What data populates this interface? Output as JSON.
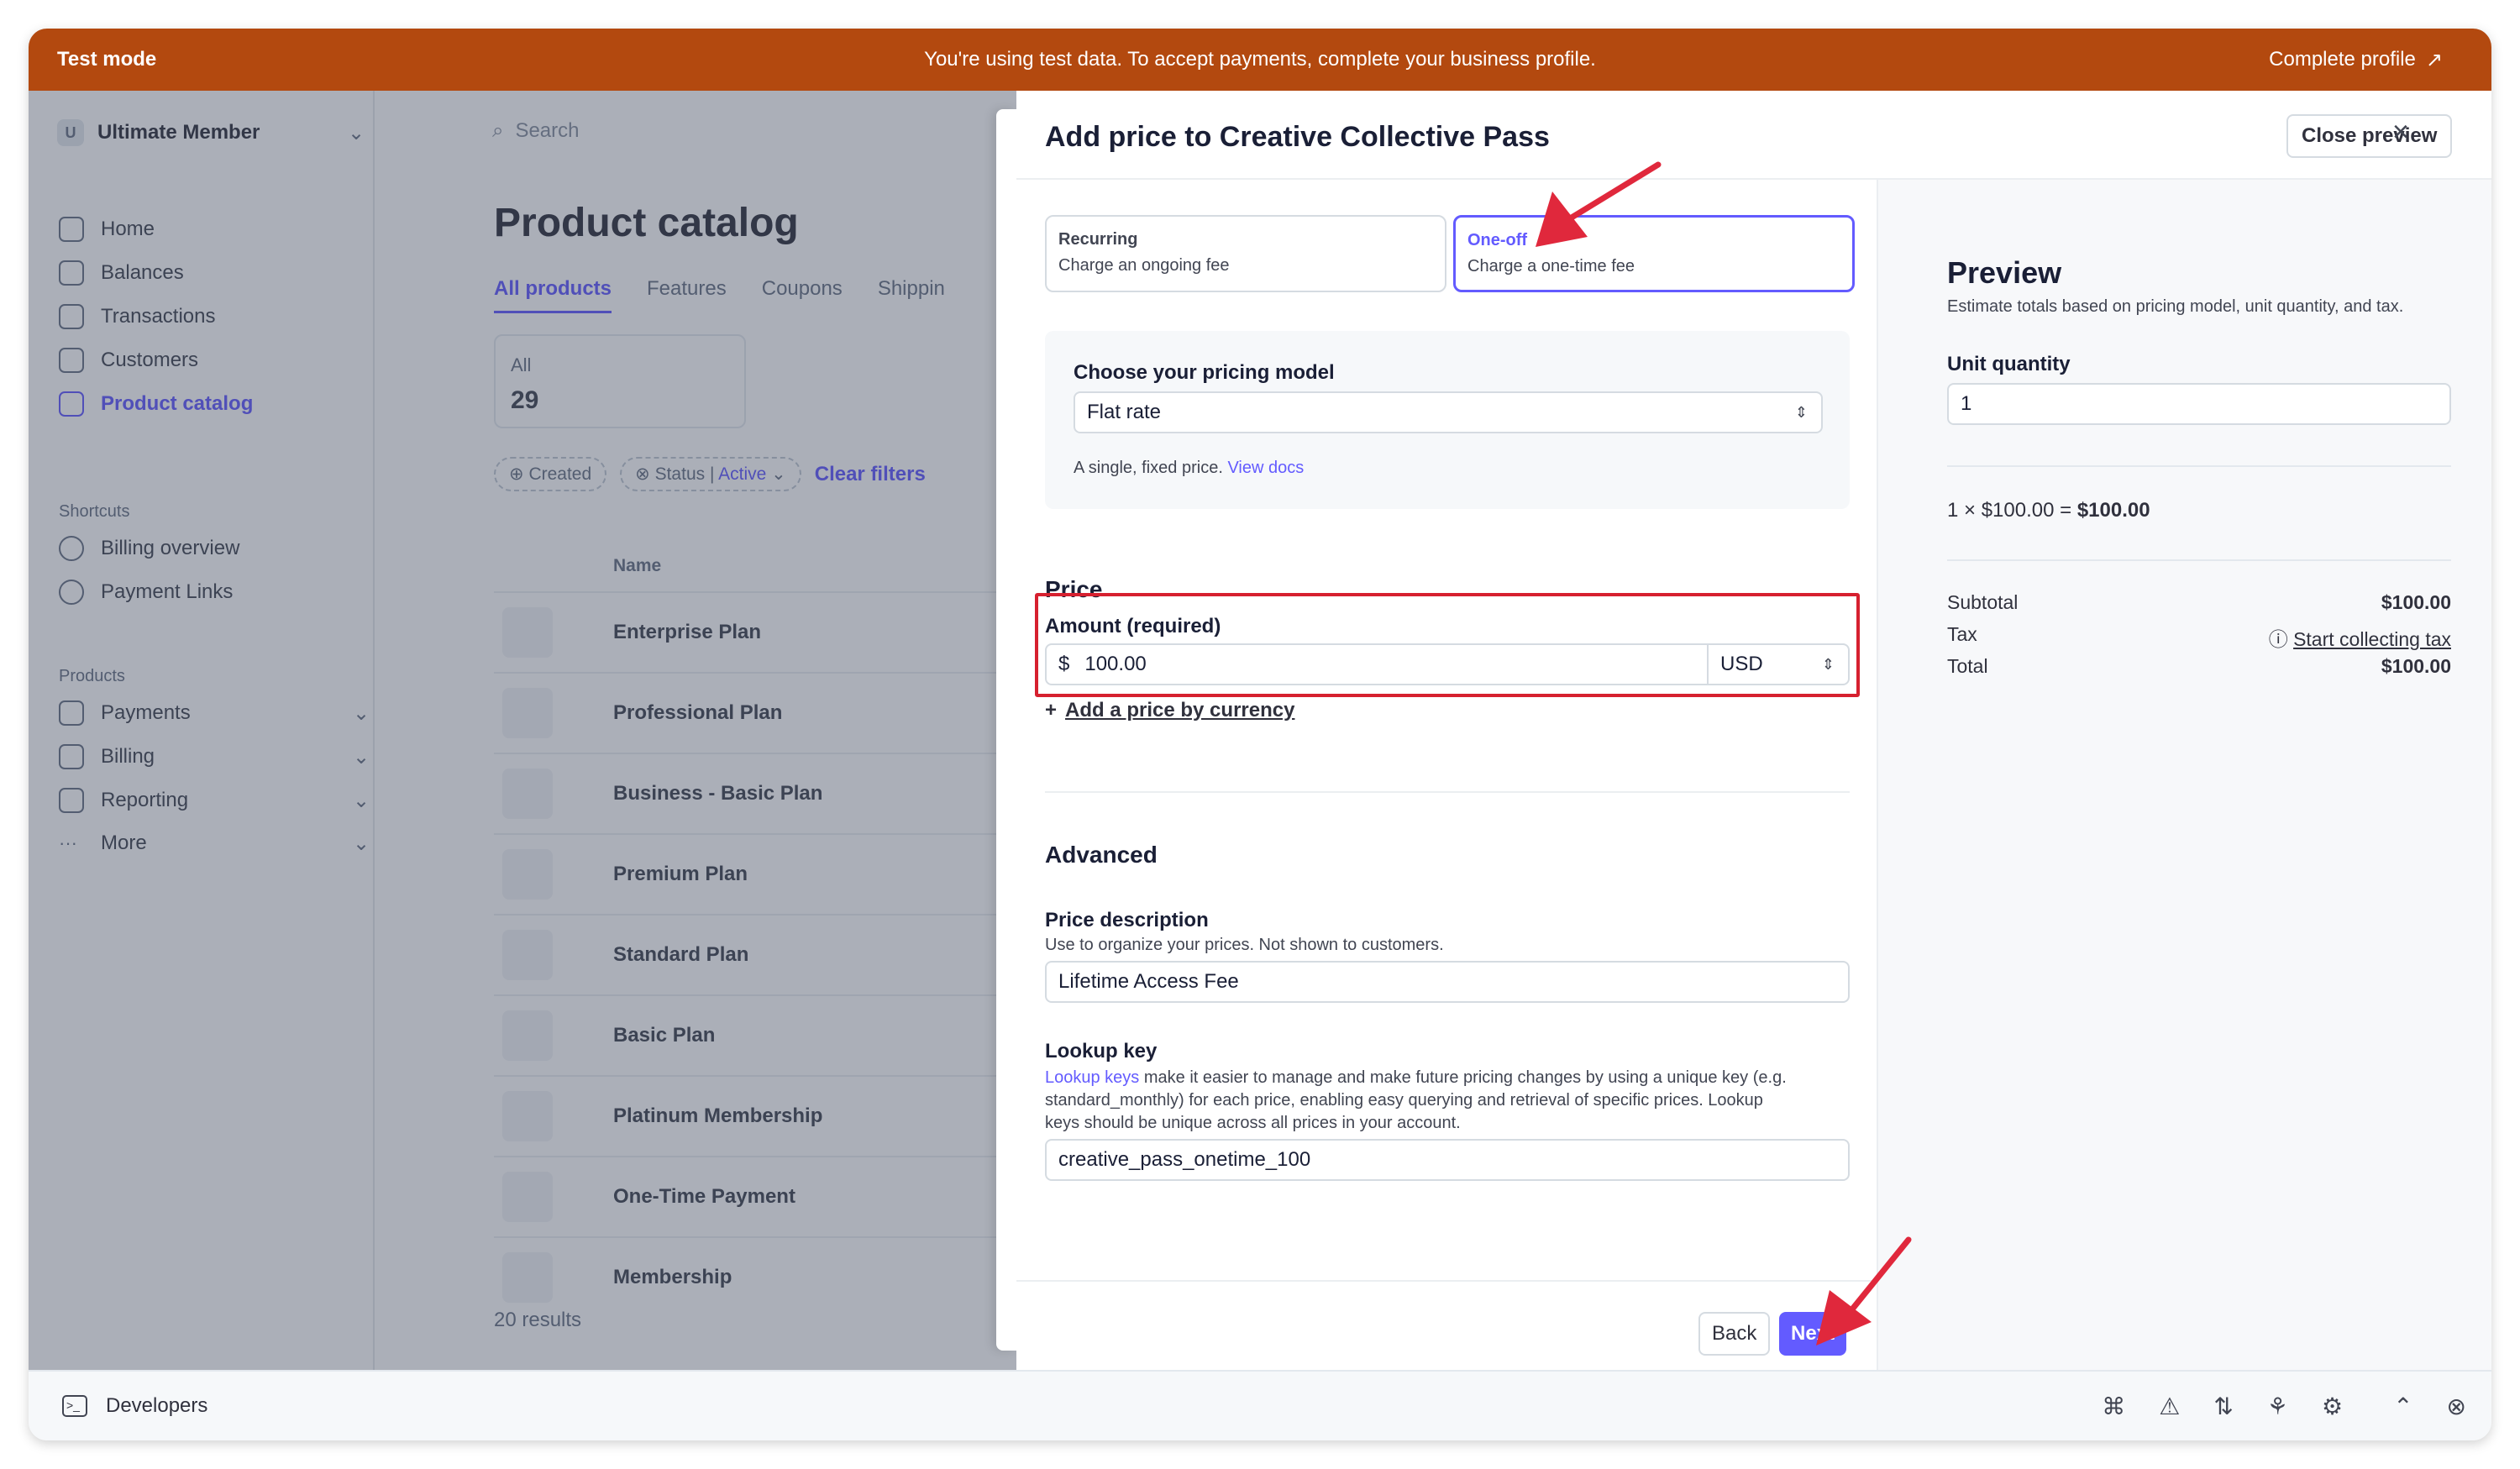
{
  "banner": {
    "mode_label": "Test mode",
    "message": "You're using test data. To accept payments, complete your business profile.",
    "complete_profile": "Complete profile"
  },
  "sidebar": {
    "account_initial": "U",
    "account_name": "Ultimate Member",
    "items": [
      {
        "label": "Home",
        "icon": "home-icon"
      },
      {
        "label": "Balances",
        "icon": "balances-icon"
      },
      {
        "label": "Transactions",
        "icon": "transactions-icon"
      },
      {
        "label": "Customers",
        "icon": "customers-icon"
      },
      {
        "label": "Product catalog",
        "icon": "product-catalog-icon"
      }
    ],
    "shortcuts_heading": "Shortcuts",
    "shortcuts": [
      {
        "label": "Billing overview",
        "icon": "clock-icon"
      },
      {
        "label": "Payment Links",
        "icon": "clock-icon"
      }
    ],
    "products_heading": "Products",
    "products": [
      {
        "label": "Payments",
        "icon": "payments-icon"
      },
      {
        "label": "Billing",
        "icon": "billing-icon"
      },
      {
        "label": "Reporting",
        "icon": "reporting-icon"
      },
      {
        "label": "More",
        "icon": "more-icon"
      }
    ]
  },
  "catalog": {
    "search_placeholder": "Search",
    "title": "Product catalog",
    "tabs": [
      "All products",
      "Features",
      "Coupons",
      "Shippin"
    ],
    "count_label": "All",
    "count_value": "29",
    "filter_created": "Created",
    "filter_status": "Status",
    "filter_status_value": "Active",
    "clear_filters": "Clear filters",
    "col_name": "Name",
    "products": [
      "Enterprise Plan",
      "Professional Plan",
      "Business - Basic Plan",
      "Premium Plan",
      "Standard Plan",
      "Basic Plan",
      "Platinum Membership",
      "One-Time Payment",
      "Membership"
    ],
    "results": "20 results"
  },
  "developers": {
    "label": "Developers"
  },
  "modal": {
    "title": "Add price to Creative Collective Pass",
    "close_preview": "Close preview",
    "recurring_title": "Recurring",
    "recurring_desc": "Charge an ongoing fee",
    "oneoff_title": "One-off",
    "oneoff_desc": "Charge a one-time fee",
    "pricing_model_label": "Choose your pricing model",
    "pricing_model_value": "Flat rate",
    "pricing_model_help": "A single, fixed price.",
    "view_docs": "View docs",
    "price_heading": "Price",
    "amount_label": "Amount (required)",
    "currency_symbol": "$",
    "amount_value": "100.00",
    "currency": "USD",
    "add_by_currency": "Add a price by currency",
    "advanced_heading": "Advanced",
    "desc_label": "Price description",
    "desc_help": "Use to organize your prices. Not shown to customers.",
    "desc_value": "Lifetime Access Fee",
    "lookup_label": "Lookup key",
    "lookup_link": "Lookup keys",
    "lookup_help_1": " make it easier to manage and make future pricing changes by using a unique key (e.g.",
    "lookup_help_2": "standard_monthly) for each price, enabling easy querying and retrieval of specific prices. Lookup",
    "lookup_help_3": "keys should be unique across all prices in your account.",
    "lookup_value": "creative_pass_onetime_100",
    "back": "Back",
    "next": "Next"
  },
  "preview": {
    "title": "Preview",
    "subtitle": "Estimate totals based on pricing model, unit quantity, and tax.",
    "unit_qty_label": "Unit quantity",
    "unit_qty_value": "1",
    "calc_left": "1 × $100.00 =",
    "calc_result": "$100.00",
    "subtotal_label": "Subtotal",
    "subtotal_value": "$100.00",
    "tax_label": "Tax",
    "tax_link": "Start collecting tax",
    "total_label": "Total",
    "total_value": "$100.00"
  },
  "colors": {
    "banner": "#b3490f",
    "accent": "#635bff",
    "highlight_box": "#d6202f",
    "annotation_arrow": "#e0283c"
  }
}
